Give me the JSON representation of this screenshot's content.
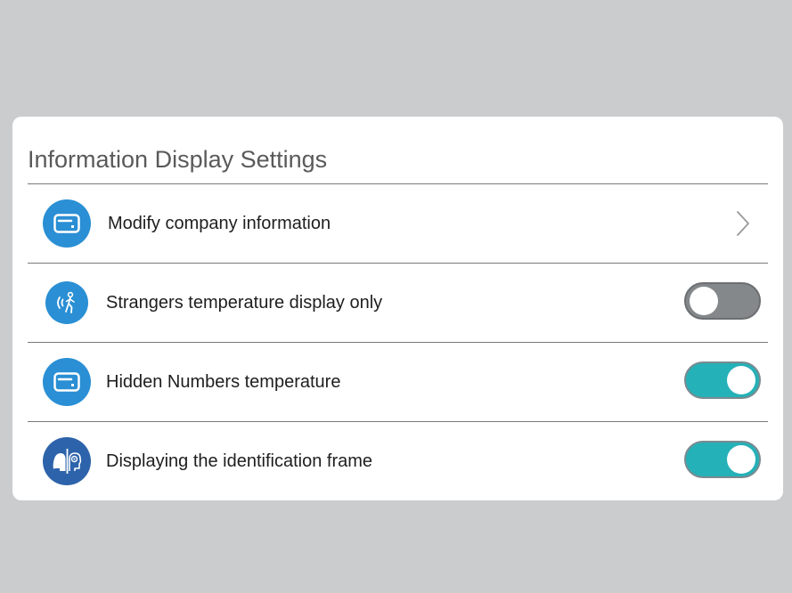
{
  "panel": {
    "title": "Information Display Settings"
  },
  "rows": [
    {
      "label": "Modify company information",
      "icon": "card-icon",
      "control": "chevron"
    },
    {
      "label": "Strangers temperature display only",
      "icon": "person-scan-icon",
      "control": "toggle",
      "on": false
    },
    {
      "label": "Hidden Numbers temperature",
      "icon": "card-icon",
      "control": "toggle",
      "on": true
    },
    {
      "label": "Displaying the identification frame",
      "icon": "face-recognition-icon",
      "control": "toggle",
      "on": true
    }
  ],
  "colors": {
    "background": "#cbcccd",
    "card": "#ffffff",
    "icon_blue": "#2a8fd4",
    "icon_dark_blue": "#2d63aa",
    "toggle_on": "#25b1b8",
    "toggle_off": "#85888a"
  }
}
